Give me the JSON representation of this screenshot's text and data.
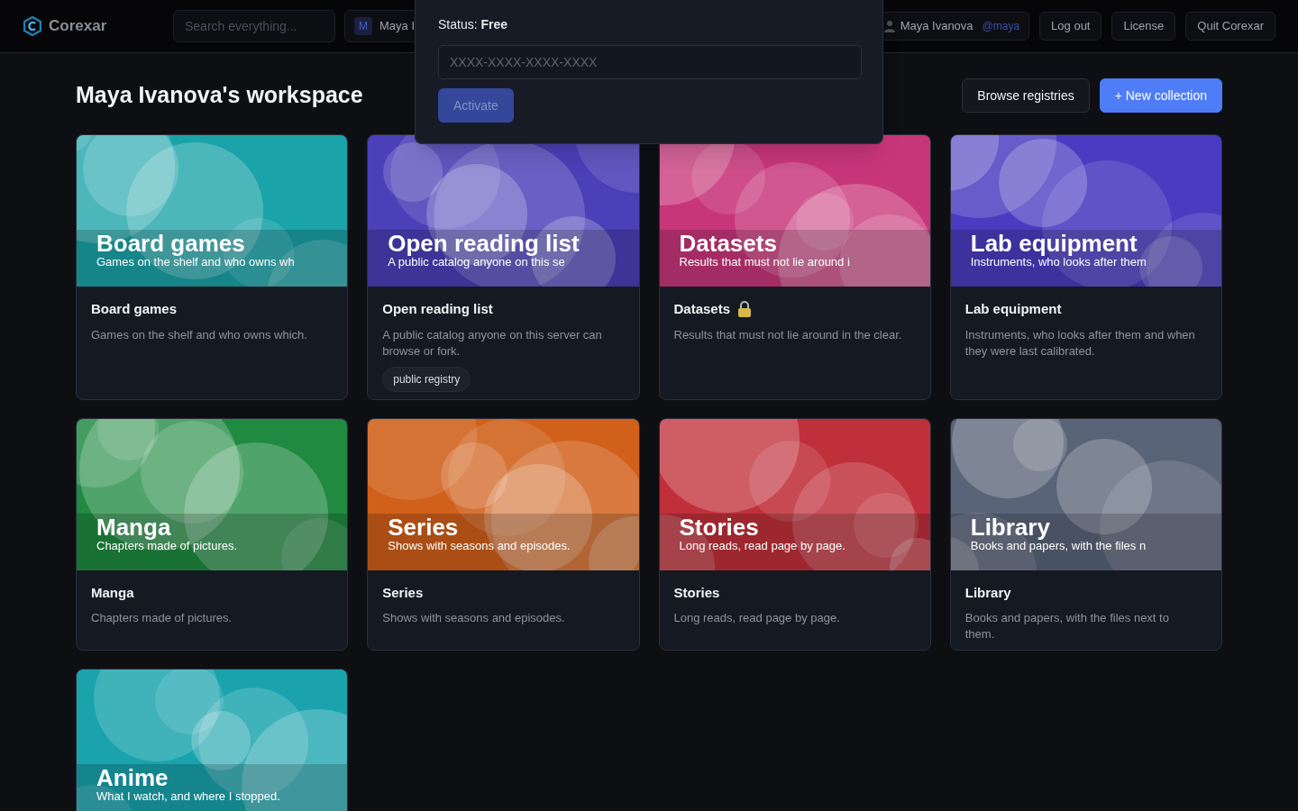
{
  "nav": {
    "logo_text": "Corexar",
    "search": {
      "placeholder": "Search everything..."
    },
    "account_chip": {
      "avatar_letter": "M",
      "name": "Maya I"
    },
    "user": {
      "name": "Maya Ivanova",
      "handle": "@maya"
    },
    "buttons": [
      "Log out",
      "License",
      "Quit Corexar"
    ]
  },
  "license_popover": {
    "status_label": "Status:",
    "status_value": "Free",
    "key_field": {
      "placeholder": "XXXX-XXXX-XXXX-XXXX"
    },
    "activate": {
      "label": "Activate",
      "disabled": true
    }
  },
  "page": {
    "title": "Maya Ivanova's workspace",
    "actions": [
      {
        "label": "Browse registries",
        "kind": "secondary"
      },
      {
        "label": "+ New collection",
        "kind": "primary"
      }
    ]
  },
  "collections": [
    {
      "banner_title": "Board games",
      "banner_subtitle": "Games on the shelf and who owns wh",
      "name": "Board games",
      "description": "Games on the shelf and who owns which.",
      "locked": false,
      "color": "#1aa3a8"
    },
    {
      "banner_title": "Open reading list",
      "banner_subtitle": "A public catalog anyone on this se",
      "name": "Open reading list",
      "description": "A public catalog anyone on this server can browse or fork.",
      "tags": [
        "public registry"
      ],
      "locked": false,
      "color": "#4a40b8"
    },
    {
      "banner_title": "Datasets",
      "banner_subtitle": "Results that must not lie around i",
      "name": "Datasets",
      "description": "Results that must not lie around in the clear.",
      "locked": true,
      "color": "#c8367a"
    },
    {
      "banner_title": "Lab equipment",
      "banner_subtitle": "Instruments, who looks after them",
      "name": "Lab equipment",
      "description": "Instruments, who looks after them and when they were last calibrated.",
      "locked": false,
      "color": "#4a3cc0"
    },
    {
      "banner_title": "Manga",
      "banner_subtitle": "Chapters made of pictures.",
      "name": "Manga",
      "description": "Chapters made of pictures.",
      "locked": false,
      "color": "#1f8a40"
    },
    {
      "banner_title": "Series",
      "banner_subtitle": "Shows with seasons and episodes.",
      "name": "Series",
      "description": "Shows with seasons and episodes.",
      "locked": false,
      "color": "#d0601a"
    },
    {
      "banner_title": "Stories",
      "banner_subtitle": "Long reads, read page by page.",
      "name": "Stories",
      "description": "Long reads, read page by page.",
      "locked": false,
      "color": "#c0303a"
    },
    {
      "banner_title": "Library",
      "banner_subtitle": "Books and papers, with the files n",
      "name": "Library",
      "description": "Books and papers, with the files next to them.",
      "locked": false,
      "color": "#5a6478"
    },
    {
      "banner_title": "Anime",
      "banner_subtitle": "What I watch, and where I stopped.",
      "color": "#1aa3ad"
    }
  ]
}
